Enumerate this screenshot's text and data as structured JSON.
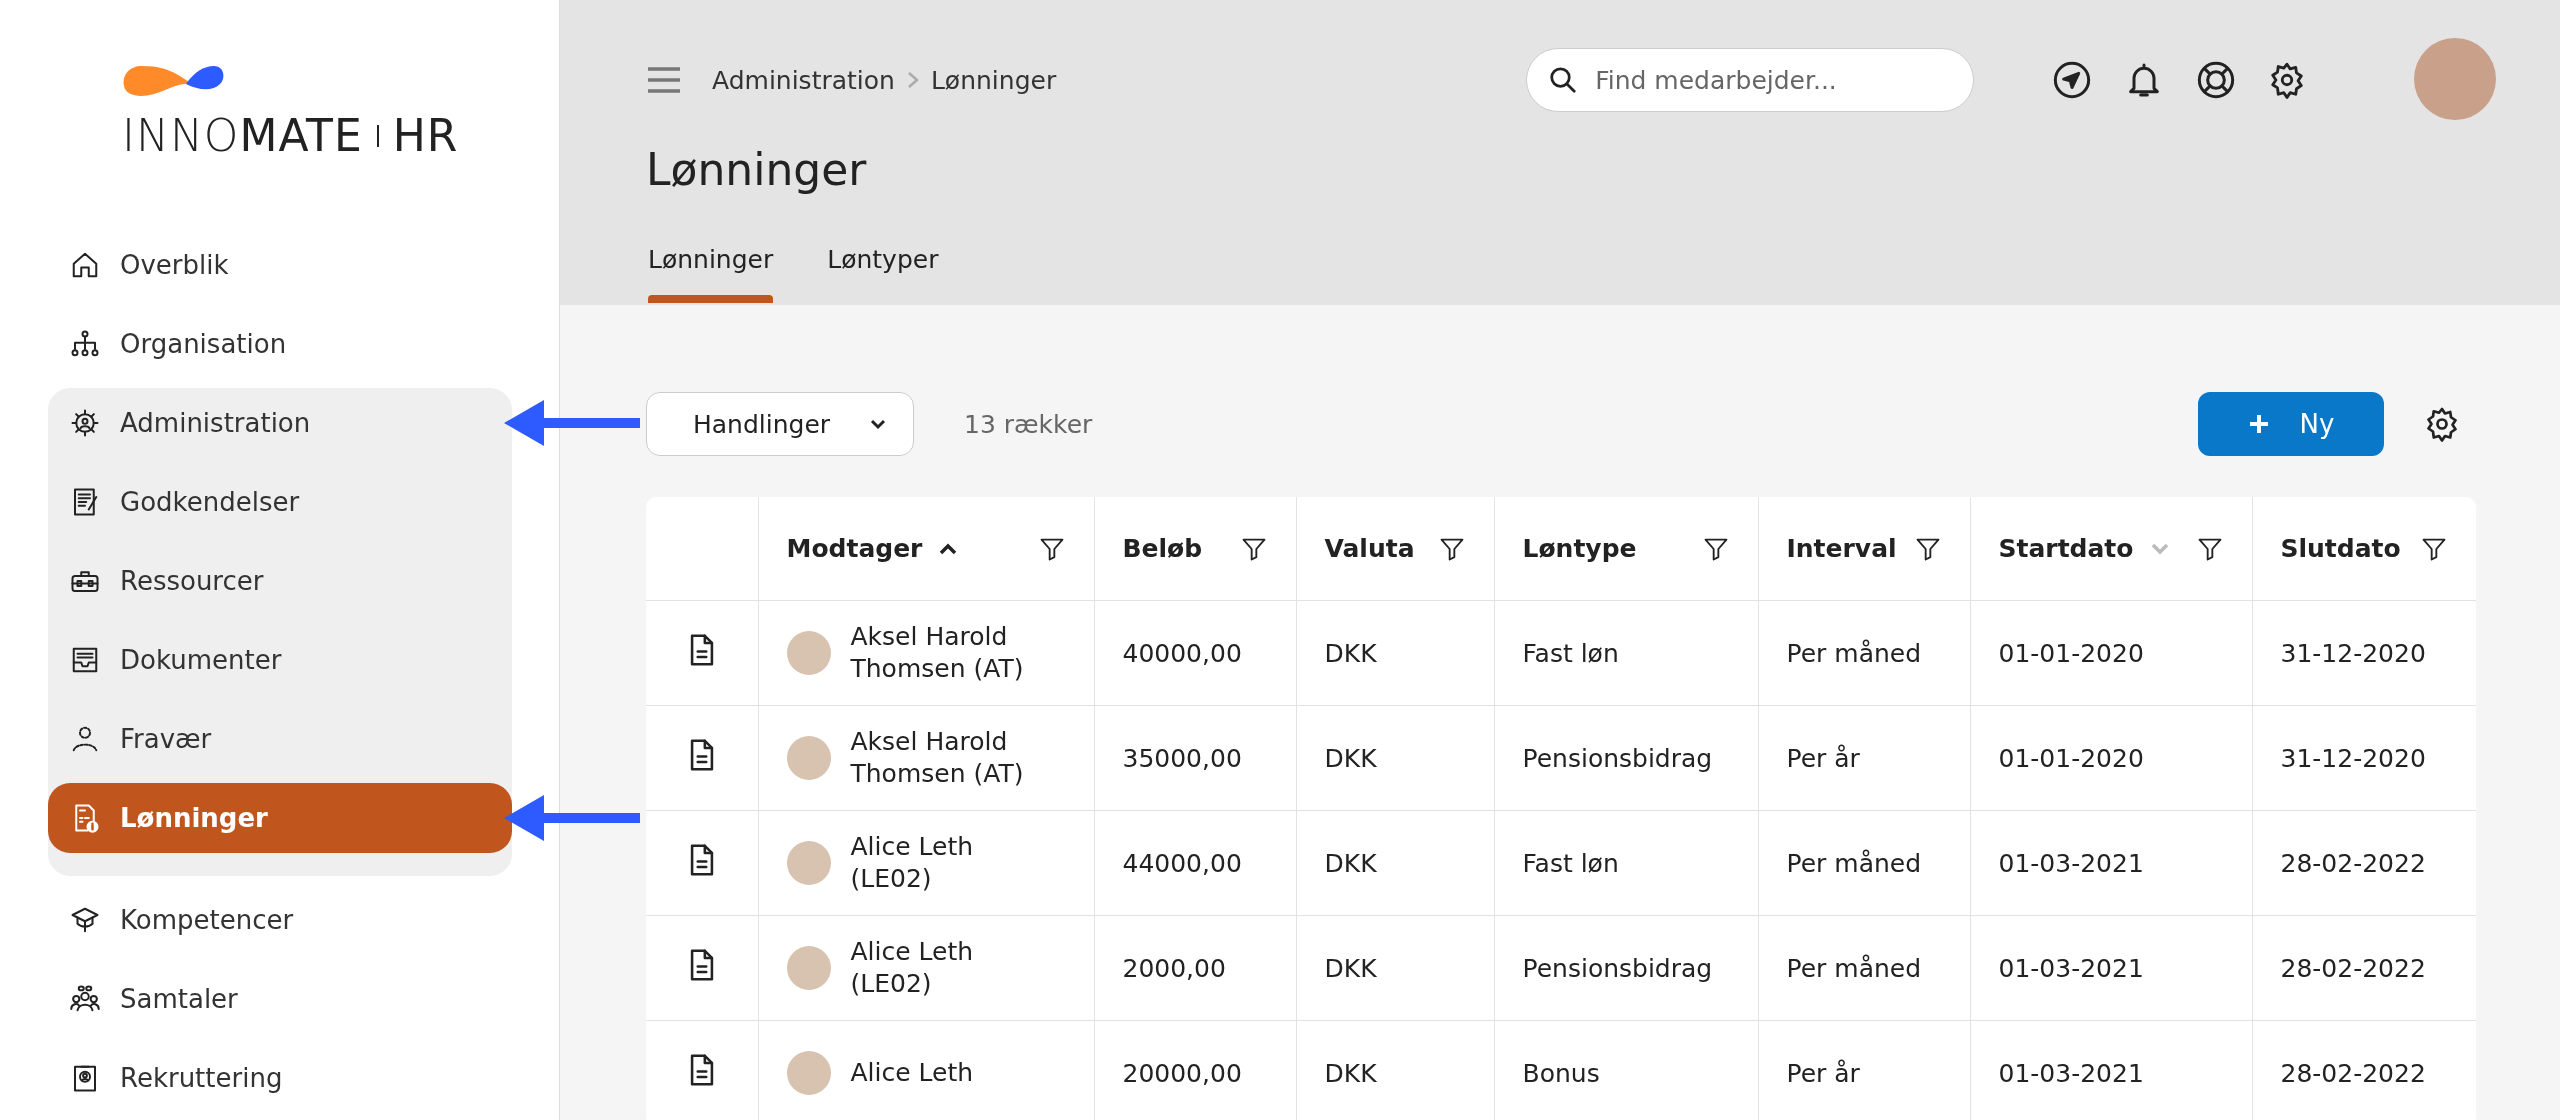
{
  "logo": {
    "text_light": "INNO",
    "text_bold": "MATE",
    "product": "HR"
  },
  "sidebar": {
    "items": [
      {
        "label": "Overblik",
        "selected": false,
        "annotated": false
      },
      {
        "label": "Organisation",
        "selected": false,
        "annotated": false
      },
      {
        "label": "Administration",
        "selected": false,
        "annotated": true,
        "expanded": true,
        "children": [
          {
            "label": "Godkendelser",
            "selected": false,
            "annotated": false
          },
          {
            "label": "Ressourcer",
            "selected": false,
            "annotated": false
          },
          {
            "label": "Dokumenter",
            "selected": false,
            "annotated": false
          },
          {
            "label": "Fravær",
            "selected": false,
            "annotated": false
          },
          {
            "label": "Lønninger",
            "selected": true,
            "annotated": true
          }
        ]
      },
      {
        "label": "Kompetencer",
        "selected": false,
        "annotated": false
      },
      {
        "label": "Samtaler",
        "selected": false,
        "annotated": false
      },
      {
        "label": "Rekruttering",
        "selected": false,
        "annotated": false
      }
    ]
  },
  "header": {
    "breadcrumb": [
      "Administration",
      "Lønninger"
    ],
    "search": {
      "placeholder": "Find medarbejder..."
    },
    "title": "Lønninger",
    "tabs": [
      {
        "label": "Lønninger",
        "selected": true
      },
      {
        "label": "Løntyper",
        "selected": false
      }
    ]
  },
  "toolbar": {
    "actions_dropdown": "Handlinger",
    "row_count": "13 rækker",
    "new_button": "Ny"
  },
  "table": {
    "columns": [
      {
        "kind": "icon"
      },
      {
        "kind": "text",
        "label": "Modtager",
        "sorted": true,
        "sort_hint": false
      },
      {
        "kind": "text",
        "label": "Beløb",
        "sorted": false,
        "sort_hint": false
      },
      {
        "kind": "text",
        "label": "Valuta",
        "sorted": false,
        "sort_hint": false
      },
      {
        "kind": "text",
        "label": "Løntype",
        "sorted": false,
        "sort_hint": false
      },
      {
        "kind": "text",
        "label": "Interval",
        "sorted": false,
        "sort_hint": false
      },
      {
        "kind": "text",
        "label": "Startdato",
        "sorted": false,
        "sort_hint": true
      },
      {
        "kind": "text",
        "label": "Slutdato",
        "sorted": false,
        "sort_hint": false
      }
    ],
    "rows": [
      {
        "cells": [
          "",
          "Aksel Harold Thomsen (AT)",
          "40000,00",
          "DKK",
          "Fast løn",
          "Per måned",
          "01-01-2020",
          "31-12-2020"
        ]
      },
      {
        "cells": [
          "",
          "Aksel Harold Thomsen (AT)",
          "35000,00",
          "DKK",
          "Pensionsbidrag",
          "Per år",
          "01-01-2020",
          "31-12-2020"
        ]
      },
      {
        "cells": [
          "",
          "Alice Leth (LE02)",
          "44000,00",
          "DKK",
          "Fast løn",
          "Per måned",
          "01-03-2021",
          "28-02-2022"
        ]
      },
      {
        "cells": [
          "",
          "Alice Leth (LE02)",
          "2000,00",
          "DKK",
          "Pensionsbidrag",
          "Per måned",
          "01-03-2021",
          "28-02-2022"
        ]
      },
      {
        "cells": [
          "",
          "Alice Leth",
          "20000,00",
          "DKK",
          "Bonus",
          "Per år",
          "01-03-2021",
          "28-02-2022"
        ]
      }
    ]
  }
}
